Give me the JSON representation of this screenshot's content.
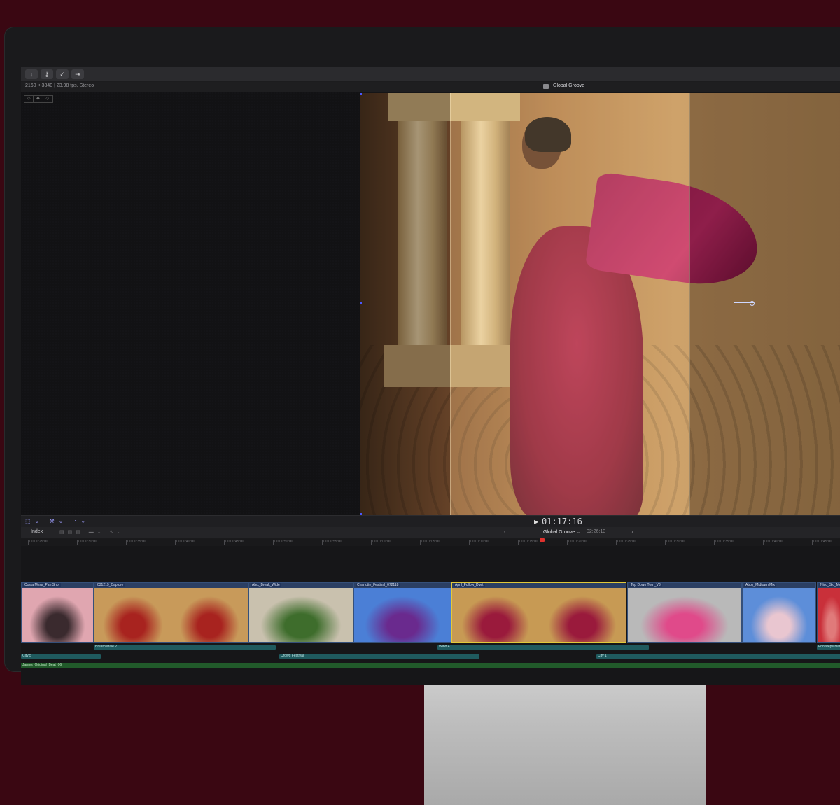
{
  "toolbar": {
    "buttons": [
      {
        "name": "import-icon",
        "glyph": "↓"
      },
      {
        "name": "keywords-icon",
        "glyph": "⚷"
      },
      {
        "name": "background-tasks-icon",
        "glyph": "✓"
      },
      {
        "name": "share-icon",
        "glyph": "⇥"
      }
    ]
  },
  "info": {
    "format": "2160 × 3840 | 23.98 fps, Stereo",
    "project_title": "Global Groove"
  },
  "viewer": {
    "timecode": "01:17:16",
    "play_glyph": "▶"
  },
  "timeline": {
    "index_label": "Index",
    "project_name": "Global Groove ⌄",
    "duration": "02:26:13",
    "prev_glyph": "‹",
    "next_glyph": "›",
    "ruler_ticks": [
      "00:00:25:00",
      "00:00:30:00",
      "00:00:35:00",
      "00:00:40:00",
      "00:00:45:00",
      "00:00:50:00",
      "00:00:55:00",
      "00:01:00:00",
      "00:01:05:00",
      "00:01:10:00",
      "00:01:15:00",
      "00:01:20:00",
      "00:01:25:00",
      "00:01:30:00",
      "00:01:35:00",
      "00:01:40:00",
      "00:01:45:00"
    ],
    "clips": [
      {
        "label": "Costa Mesa_Pan Shot",
        "colors": [
          "#e0a6b0",
          "#3a2a2e"
        ]
      },
      {
        "label": "031219_Capture",
        "colors": [
          "#c89a5a",
          "#a8231f"
        ]
      },
      {
        "label": "Alex_Break_Wide",
        "colors": [
          "#c9c1ae",
          "#3e6d2c"
        ]
      },
      {
        "label": "Charlotte_Festival_072118",
        "colors": [
          "#4b7fd6",
          "#6a2a8e"
        ]
      },
      {
        "label": "April_Follow_Duet",
        "colors": [
          "#c79a54",
          "#9a1a3c"
        ]
      },
      {
        "label": "Top Down Twirl_V3",
        "colors": [
          "#b9b9b9",
          "#e04a8a"
        ]
      },
      {
        "label": "Abby_Midtown Mix",
        "colors": [
          "#5d8ed9",
          "#e9c6d0"
        ]
      },
      {
        "label": "Nico_Slo_Mo_",
        "colors": [
          "#c9303a",
          "#e07a7a"
        ]
      }
    ],
    "audio": [
      {
        "label": "Breath Male 2"
      },
      {
        "label": "Wind 4"
      },
      {
        "label": "Footsteps Hard"
      },
      {
        "label": "City 5"
      },
      {
        "label": "Crowd Festival"
      },
      {
        "label": "City 1"
      }
    ],
    "music": {
      "label": "James_Original_Beat_06"
    }
  },
  "colors": {
    "background": "#3a0712",
    "playhead": "#e0322e",
    "selected_clip": "#e2c93a",
    "audio_clip": "#1f5a5e",
    "music_clip": "#215a2a"
  }
}
